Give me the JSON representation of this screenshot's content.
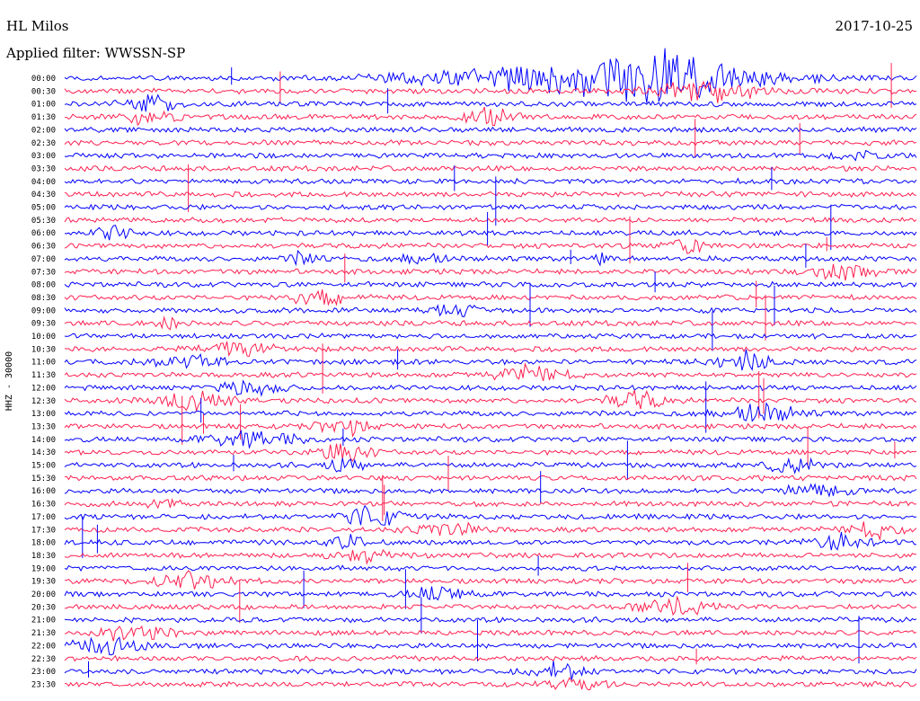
{
  "header": {
    "station": "HL Milos",
    "filter": "Applied filter: WWSSN-SP",
    "date": "2017-10-25"
  },
  "chart_data": {
    "type": "line",
    "title": "HL Milos",
    "ylabel": "HHZ - 30000",
    "rows": [
      "00:00",
      "00:30",
      "01:00",
      "01:30",
      "02:00",
      "02:30",
      "03:00",
      "03:30",
      "04:00",
      "04:30",
      "05:00",
      "05:30",
      "06:00",
      "06:30",
      "07:00",
      "07:30",
      "08:00",
      "08:30",
      "09:00",
      "09:30",
      "10:00",
      "10:30",
      "11:00",
      "11:30",
      "12:00",
      "12:30",
      "13:00",
      "13:30",
      "14:00",
      "14:30",
      "15:00",
      "15:30",
      "16:00",
      "16:30",
      "17:00",
      "17:30",
      "18:00",
      "18:30",
      "19:00",
      "19:30",
      "20:00",
      "20:30",
      "21:00",
      "21:30",
      "22:00",
      "22:30",
      "23:00",
      "23:30"
    ],
    "trace_colors": [
      "#0000ff",
      "#ff2050"
    ],
    "events": [
      [
        0,
        0.62,
        0.18,
        6
      ],
      [
        0,
        0.7,
        0.08,
        5
      ],
      [
        1,
        0.75,
        0.06,
        4
      ],
      [
        2,
        0.1,
        0.03,
        3
      ],
      [
        3,
        0.5,
        0.03,
        3
      ],
      [
        3,
        0.1,
        0.03,
        2.5
      ],
      [
        6,
        0.93,
        0.02,
        2
      ],
      [
        12,
        0.06,
        0.02,
        3
      ],
      [
        13,
        0.73,
        0.02,
        3
      ],
      [
        14,
        0.28,
        0.02,
        2
      ],
      [
        14,
        0.42,
        0.02,
        2
      ],
      [
        14,
        0.63,
        0.01,
        2.5
      ],
      [
        15,
        0.91,
        0.04,
        3
      ],
      [
        17,
        0.3,
        0.03,
        3
      ],
      [
        18,
        0.46,
        0.02,
        4
      ],
      [
        19,
        0.12,
        0.02,
        2
      ],
      [
        21,
        0.21,
        0.04,
        3
      ],
      [
        22,
        0.15,
        0.04,
        2
      ],
      [
        22,
        0.8,
        0.03,
        4
      ],
      [
        23,
        0.55,
        0.04,
        3
      ],
      [
        24,
        0.22,
        0.04,
        3
      ],
      [
        25,
        0.15,
        0.04,
        3
      ],
      [
        25,
        0.67,
        0.03,
        3.5
      ],
      [
        26,
        0.82,
        0.04,
        3
      ],
      [
        27,
        0.33,
        0.03,
        3
      ],
      [
        28,
        0.22,
        0.05,
        3
      ],
      [
        29,
        0.33,
        0.03,
        3
      ],
      [
        30,
        0.33,
        0.02,
        2.5
      ],
      [
        30,
        0.85,
        0.03,
        3
      ],
      [
        32,
        0.88,
        0.04,
        2.5
      ],
      [
        33,
        0.12,
        0.02,
        2
      ],
      [
        34,
        0.36,
        0.03,
        4
      ],
      [
        35,
        0.45,
        0.04,
        2.5
      ],
      [
        35,
        0.95,
        0.03,
        3
      ],
      [
        36,
        0.33,
        0.02,
        2.5
      ],
      [
        36,
        0.91,
        0.03,
        3
      ],
      [
        37,
        0.35,
        0.03,
        2.5
      ],
      [
        39,
        0.15,
        0.04,
        3
      ],
      [
        40,
        0.44,
        0.03,
        3
      ],
      [
        41,
        0.72,
        0.04,
        3
      ],
      [
        43,
        0.08,
        0.04,
        3
      ],
      [
        44,
        0.05,
        0.04,
        3
      ],
      [
        46,
        0.58,
        0.03,
        3
      ],
      [
        47,
        0.6,
        0.03,
        2
      ]
    ]
  }
}
